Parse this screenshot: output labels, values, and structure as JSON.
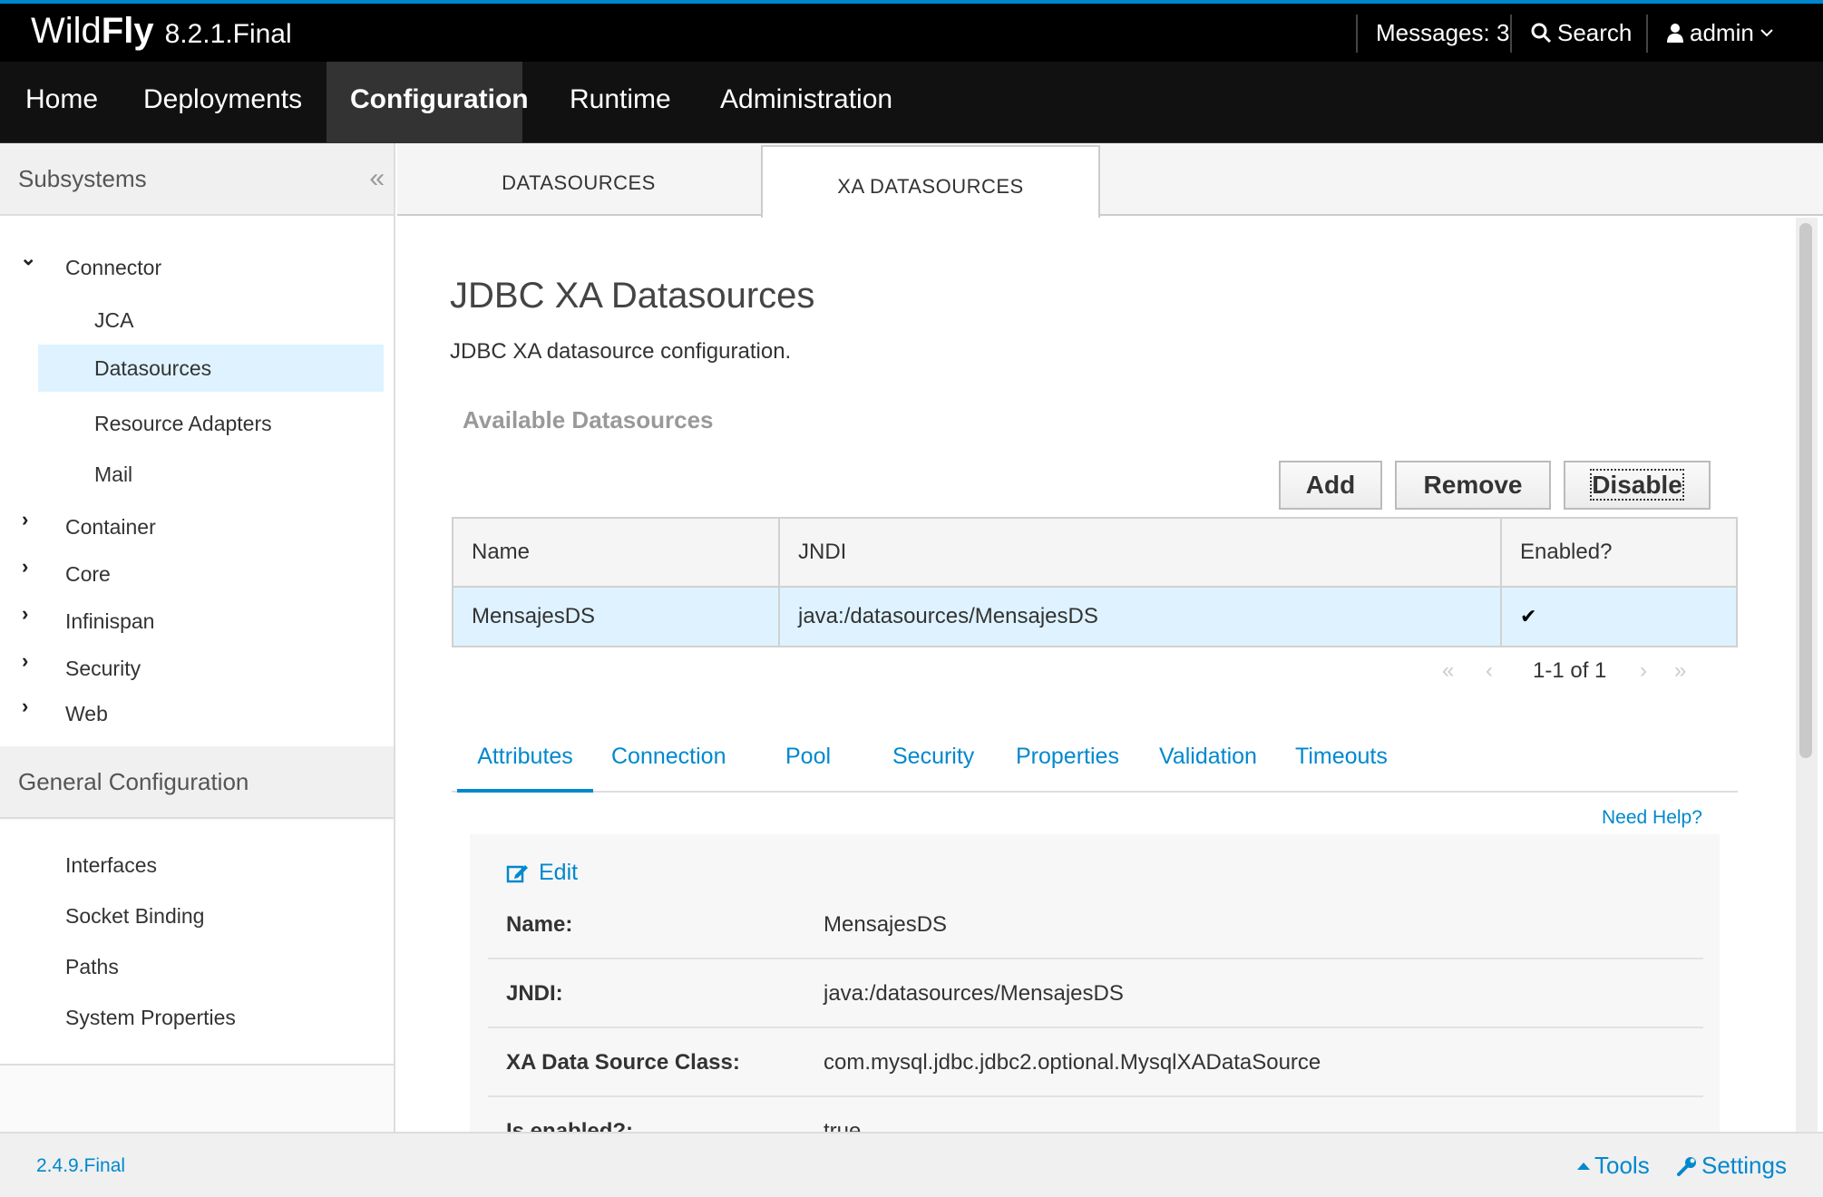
{
  "header": {
    "brand_prefix": "Wild",
    "brand_bold": "Fly",
    "version": "8.2.1.Final",
    "messages": "Messages: 3",
    "search": "Search",
    "user": "admin"
  },
  "nav": {
    "items": [
      "Home",
      "Deployments",
      "Configuration",
      "Runtime",
      "Administration"
    ],
    "active": "Configuration"
  },
  "sidebar": {
    "subsystems_title": "Subsystems",
    "connector": "Connector",
    "connector_children": [
      "JCA",
      "Datasources",
      "Resource Adapters",
      "Mail"
    ],
    "selected": "Datasources",
    "groups": [
      "Container",
      "Core",
      "Infinispan",
      "Security",
      "Web"
    ],
    "general_title": "General Configuration",
    "general_items": [
      "Interfaces",
      "Socket Binding",
      "Paths",
      "System Properties"
    ]
  },
  "tabs": {
    "datasources": "DATASOURCES",
    "xa_datasources": "XA DATASOURCES",
    "active": "XA DATASOURCES"
  },
  "main": {
    "title": "JDBC XA Datasources",
    "description": "JDBC XA datasource configuration.",
    "subtitle": "Available Datasources",
    "buttons": {
      "add": "Add",
      "remove": "Remove",
      "disable": "Disable"
    },
    "table": {
      "headers": [
        "Name",
        "JNDI",
        "Enabled?"
      ],
      "rows": [
        {
          "name": "MensajesDS",
          "jndi": "java:/datasources/MensajesDS",
          "enabled": "✔"
        }
      ]
    },
    "pager": {
      "text": "1-1 of 1",
      "first": "«",
      "prev": "‹",
      "next": "›",
      "last": "»"
    },
    "subtabs": [
      "Attributes",
      "Connection",
      "Pool",
      "Security",
      "Properties",
      "Validation",
      "Timeouts"
    ],
    "active_subtab": "Attributes",
    "need_help": "Need Help?",
    "edit": "Edit",
    "attributes": [
      {
        "label": "Name:",
        "value": "MensajesDS"
      },
      {
        "label": "JNDI:",
        "value": "java:/datasources/MensajesDS"
      },
      {
        "label": "XA Data Source Class:",
        "value": "com.mysql.jdbc.jdbc2.optional.MysqlXADataSource"
      },
      {
        "label": "Is enabled?:",
        "value": "true"
      }
    ]
  },
  "footer": {
    "version": "2.4.9.Final",
    "tools": "Tools",
    "settings": "Settings"
  },
  "colors": {
    "accent": "#0088ce",
    "selected_bg": "#def3ff",
    "topbar_bg": "#000000"
  }
}
